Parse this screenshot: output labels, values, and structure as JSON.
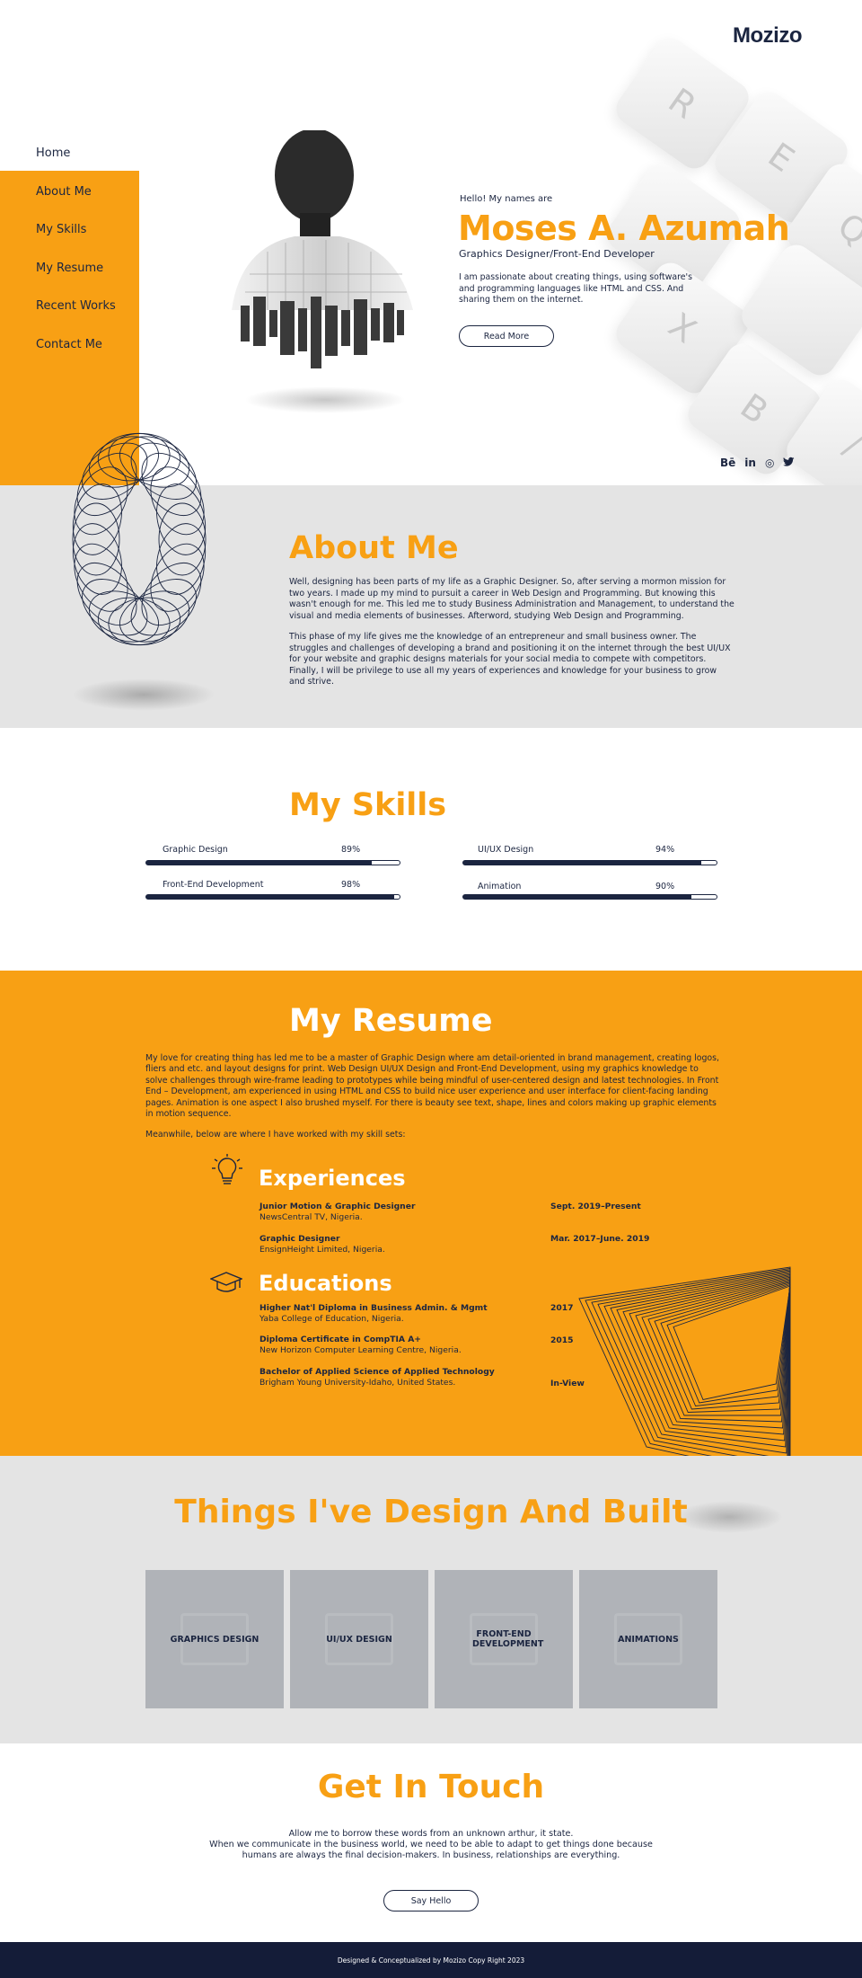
{
  "logo": "Mozizo",
  "nav": {
    "items": [
      {
        "label": "Home"
      },
      {
        "label": "About Me"
      },
      {
        "label": "My Skills"
      },
      {
        "label": "My Resume"
      },
      {
        "label": "Recent Works"
      },
      {
        "label": "Contact Me"
      }
    ]
  },
  "hero": {
    "greeting": "Hello! My names are",
    "name": "Moses A. Azumah",
    "role": "Graphics Designer/Front-End Developer",
    "intro": "I am passionate about creating things, using software's and programming languages like HTML and CSS. And sharing them on the internet.",
    "button": "Read More",
    "keys": [
      "R",
      "E",
      "Q",
      "X",
      "B",
      "/"
    ]
  },
  "socials": [
    {
      "icon": "behance-icon",
      "glyph": "Bē"
    },
    {
      "icon": "linkedin-icon",
      "glyph": "in"
    },
    {
      "icon": "dribbble-icon",
      "glyph": "◎"
    },
    {
      "icon": "twitter-icon",
      "glyph": "🐦"
    }
  ],
  "about": {
    "title": "About Me",
    "p1": "Well, designing has been parts of my life as a Graphic Designer. So, after serving a mormon mission for two years. I made up my mind to pursuit a career in Web Design and Programming. But knowing this wasn't enough for me. This led me to study Business Administration and Management, to understand the visual and media elements of businesses. Afterword, studying Web Design and Programming.",
    "p2": "This phase of my life gives me the knowledge of an entrepreneur and small business owner. The struggles and challenges of developing a brand and positioning it on the internet through the best UI/UX for your website and graphic designs materials for your social media to compete with competitors. Finally, I will be privilege to use all my years of experiences and knowledge for your business to grow and strive."
  },
  "skills": {
    "title": "My Skills",
    "items": [
      {
        "label": "Graphic Design",
        "pct": "89%",
        "value": 0.89
      },
      {
        "label": "UI/UX Design",
        "pct": "94%",
        "value": 0.94
      },
      {
        "label": "Front-End Development",
        "pct": "98%",
        "value": 0.98
      },
      {
        "label": "Animation",
        "pct": "90%",
        "value": 0.9
      }
    ]
  },
  "resume": {
    "title": "My Resume",
    "p1": "My love for creating thing has led me to be a master of Graphic Design where am detail-oriented in brand management, creating logos, fliers and etc. and layout designs for print.  Web Design UI/UX Design and Front-End Development, using my graphics knowledge to solve challenges through wire-frame leading to prototypes while being mindful of user-centered design and latest technologies. In Front End – Development, am experienced in using HTML and CSS to build nice user experience and user interface for client-facing landing pages. Animation is one aspect I also brushed myself. For there is beauty see text, shape, lines and colors making up graphic elements in motion sequence.",
    "p2": "Meanwhile, below are where I have worked with my skill sets:",
    "experiences_title": "Experiences",
    "experiences": [
      {
        "title": "Junior Motion & Graphic Designer",
        "org": "NewsCentral TV, Nigeria.",
        "date": "Sept. 2019–Present"
      },
      {
        "title": "Graphic Designer",
        "org": "EnsignHeight Limited, Nigeria.",
        "date": "Mar. 2017–June. 2019"
      }
    ],
    "educations_title": "Educations",
    "educations": [
      {
        "title": "Higher Nat'l Diploma in Business Admin. & Mgmt",
        "org": "Yaba College of Education, Nigeria.",
        "date": "2017"
      },
      {
        "title": "Diploma Certificate in CompTIA A+",
        "org": "New Horizon Computer Learning Centre, Nigeria.",
        "date": "2015"
      },
      {
        "title": "Bachelor of Applied Science of Applied Technology",
        "org": "Brigham Young University-Idaho, United States.",
        "date": "In-View"
      }
    ]
  },
  "works": {
    "title": "Things I've Design And Built",
    "cards": [
      {
        "label": "GRAPHICS DESIGN"
      },
      {
        "label": "UI/UX DESIGN"
      },
      {
        "label": "FRONT-END DEVELOPMENT"
      },
      {
        "label": "ANIMATIONS"
      }
    ]
  },
  "contact": {
    "title": "Get In Touch",
    "line1": "Allow me to borrow these words from an unknown arthur, it state.",
    "line2": "When we communicate in the business world, we need to be able to adapt to get things done because",
    "line3": "humans are always the final decision-makers. In business, relationships are everything.",
    "button": "Say Hello"
  },
  "footer": "Designed & Conceptualized by Mozizo Copy Right 2023",
  "colors": {
    "accent": "#f8a014",
    "navy": "#1b2540",
    "gray": "#e4e4e4"
  }
}
